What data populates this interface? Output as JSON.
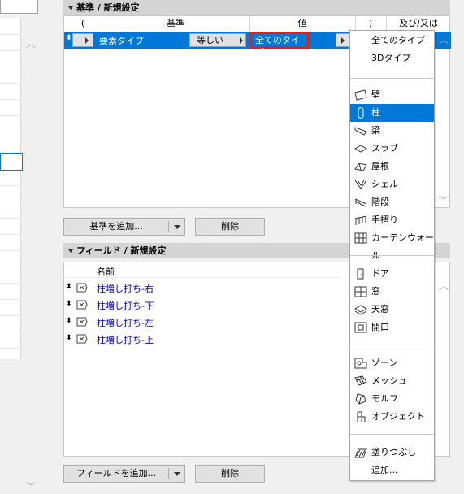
{
  "criteria": {
    "header_title": "基準 / 新規設定",
    "columns": [
      "(",
      "基準",
      "値",
      ")",
      "及び/又は"
    ],
    "row": {
      "criterion": "要素タイプ",
      "operator": "等しい",
      "value": "全てのタイプ"
    },
    "add_button": "基準を追加...",
    "delete_button": "削除"
  },
  "fields": {
    "header_title": "フィールド / 新規設定",
    "column_name": "名前",
    "rows": [
      "柱増し打ち-右",
      "柱増し打ち-下",
      "柱増し打ち-左",
      "柱増し打ち-上"
    ],
    "add_button": "フィールドを追加...",
    "delete_button": "削除"
  },
  "dropdown": {
    "top_items": [
      "全てのタイプ",
      "3Dタイプ"
    ],
    "elements": [
      {
        "label": "壁",
        "icon": "wall-icon"
      },
      {
        "label": "柱",
        "icon": "column-icon",
        "selected": true
      },
      {
        "label": "梁",
        "icon": "beam-icon"
      },
      {
        "label": "スラブ",
        "icon": "slab-icon"
      },
      {
        "label": "屋根",
        "icon": "roof-icon"
      },
      {
        "label": "シェル",
        "icon": "shell-icon"
      },
      {
        "label": "階段",
        "icon": "stair-icon"
      },
      {
        "label": "手摺り",
        "icon": "railing-icon"
      },
      {
        "label": "カーテンウォール",
        "icon": "curtain-wall-icon"
      }
    ],
    "openings": [
      {
        "label": "ドア",
        "icon": "door-icon"
      },
      {
        "label": "窓",
        "icon": "window-icon"
      },
      {
        "label": "天窓",
        "icon": "skylight-icon"
      },
      {
        "label": "開口",
        "icon": "opening-icon"
      }
    ],
    "others": [
      {
        "label": "ゾーン",
        "icon": "zone-icon"
      },
      {
        "label": "メッシュ",
        "icon": "mesh-icon"
      },
      {
        "label": "モルフ",
        "icon": "morph-icon"
      },
      {
        "label": "オブジェクト",
        "icon": "object-icon"
      }
    ],
    "fill": {
      "label": "塗りつぶし",
      "icon": "fill-icon"
    },
    "more": "追加..."
  },
  "colors": {
    "selection": "#0078d7",
    "highlight_border": "#e0201e",
    "link_text": "#0000c0"
  }
}
